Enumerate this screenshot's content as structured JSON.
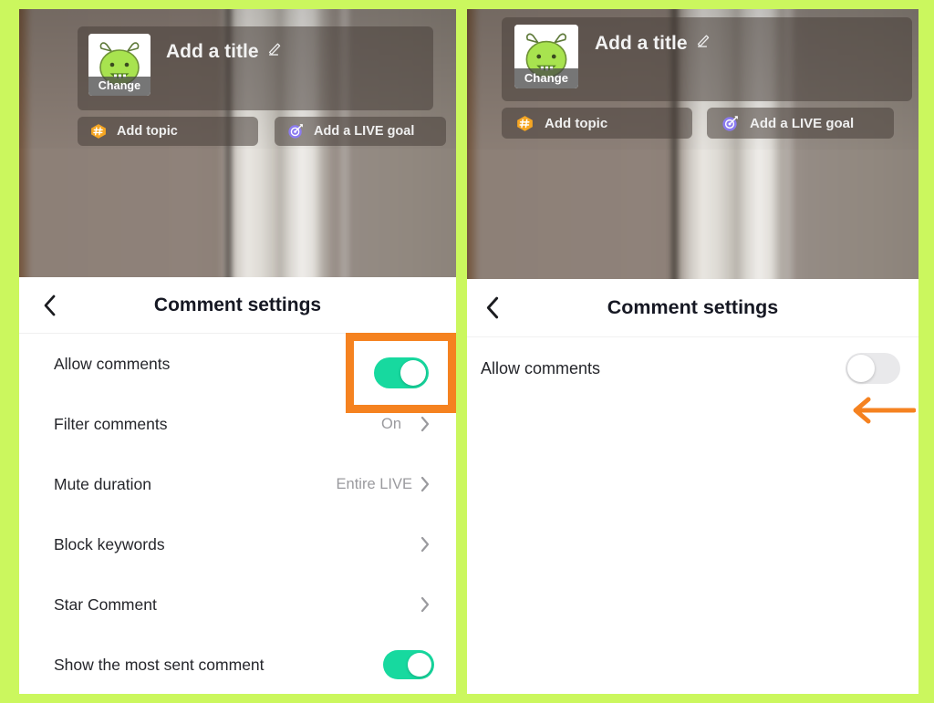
{
  "meta": {
    "background_color": "#cbf75e",
    "accent_annotation_color": "#f58220",
    "toggle_on_color": "#17d99f",
    "toggle_off_color": "#e9e9eb"
  },
  "live_setup": {
    "title_placeholder": "Add a title",
    "edit_icon": "pencil-icon",
    "avatar_change_label": "Change",
    "avatar_icon": "green-monster-avatar",
    "chips": [
      {
        "label": "Add topic",
        "icon": "hashtag-icon",
        "icon_color": "#f5a623"
      },
      {
        "label": "Add a LIVE goal",
        "icon": "target-goal-icon",
        "icon_color": "#8b7bf0"
      }
    ]
  },
  "left_panel": {
    "header": {
      "back_icon": "chevron-left-icon",
      "title": "Comment settings"
    },
    "rows": [
      {
        "label": "Allow comments",
        "control": "toggle",
        "state": "on",
        "value": "",
        "chevron": false,
        "highlighted": true
      },
      {
        "label": "Filter comments",
        "control": "link",
        "state": "",
        "value": "On",
        "chevron": true,
        "highlighted": false
      },
      {
        "label": "Mute duration",
        "control": "link",
        "state": "",
        "value": "Entire LIVE",
        "chevron": true,
        "highlighted": false
      },
      {
        "label": "Block keywords",
        "control": "link",
        "state": "",
        "value": "",
        "chevron": true,
        "highlighted": false
      },
      {
        "label": "Star Comment",
        "control": "link",
        "state": "",
        "value": "",
        "chevron": true,
        "highlighted": false
      },
      {
        "label": "Show the most sent comment",
        "control": "toggle",
        "state": "on",
        "value": "",
        "chevron": false,
        "highlighted": false
      }
    ]
  },
  "right_panel": {
    "header": {
      "back_icon": "chevron-left-icon",
      "title": "Comment settings"
    },
    "rows": [
      {
        "label": "Allow comments",
        "control": "toggle",
        "state": "off",
        "value": "",
        "chevron": false
      }
    ],
    "annotation": {
      "icon": "arrow-left-icon",
      "color": "#f58220"
    }
  }
}
